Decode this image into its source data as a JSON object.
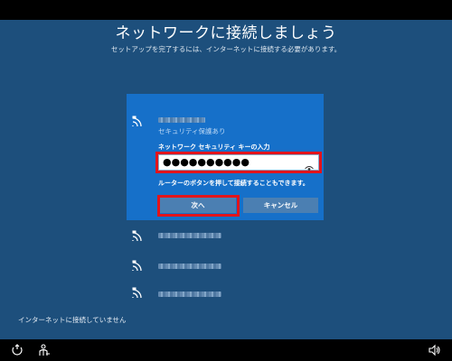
{
  "page": {
    "title": "ネットワークに接続しましょう",
    "subtitle": "セットアップを完了するには、インターネットに接続する必要があります。"
  },
  "selected_network": {
    "security_status": "セキュリティ保護あり",
    "key_label": "ネットワーク セキュリティ キーの入力",
    "password_value": "●●●●●●●●●●",
    "reveal_icon": "eye-icon",
    "router_note": "ルーターのボタンを押して接続することもできます。",
    "next_label": "次へ",
    "cancel_label": "キャンセル"
  },
  "other_networks_count_shown": 3,
  "footer": {
    "status_text": "インターネットに接続していません",
    "left_icons": [
      "ease-of-access-icon",
      "accessibility-person-icon"
    ],
    "right_icons": [
      "speaker-icon"
    ]
  },
  "colors": {
    "background": "#1d4f7c",
    "panel": "#1670c9",
    "button": "#4b7fb2",
    "highlight": "#e2141b",
    "secured_text": "#bcd8f5"
  }
}
